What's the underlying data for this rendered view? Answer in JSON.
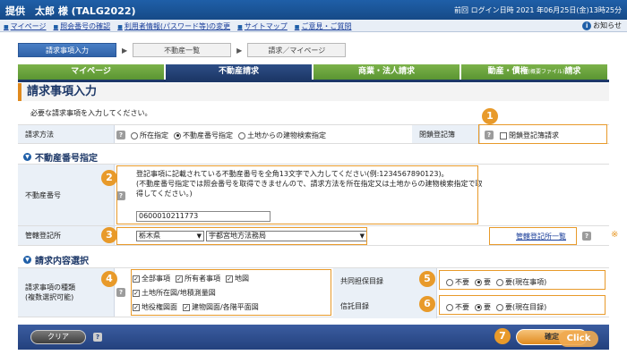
{
  "header": {
    "user_name": "提供　太郎 様 (TALG2022)",
    "last_login": "前回 ログイン日時 2021 年06月25日(金)13時25分"
  },
  "nav": {
    "links": [
      "マイページ",
      "照会番号の確認",
      "利用者情報(パスワード等)の変更",
      "サイトマップ",
      "ご意見・ご質問"
    ],
    "notice": "お知らせ"
  },
  "steps": [
    "請求事項入力",
    "不動産一覧",
    "請求／マイページ"
  ],
  "tabs": [
    {
      "label": "マイページ"
    },
    {
      "label": "不動産請求"
    },
    {
      "label": "商業・法人請求"
    },
    {
      "label": "動産・債権",
      "small": "(概要ファイル)",
      "suffix": "請求"
    }
  ],
  "page_title": "請求事項入力",
  "instruction": "必要な請求事項を入力してください。",
  "request_method": {
    "label": "請求方法",
    "options": [
      "所在指定",
      "不動産番号指定",
      "土地からの建物検索指定"
    ],
    "selected": "不動産番号指定",
    "closed_label": "閉鎖登記簿",
    "closed_checkbox": "閉鎖登記簿請求"
  },
  "property_section": {
    "heading": "不動産番号指定",
    "number_label": "不動産番号",
    "note_line1": "登記事項に記載されている不動産番号を全角13文字で入力してください(例:1234567890123)。",
    "note_line2": "(不動産番号指定では照会番号を取得できませんので、請求方法を所在指定又は土地からの建物検索指定で取得してください。)",
    "number_value": "0600010211773",
    "registry_label": "管轄登記所",
    "prefecture": "栃木県",
    "office": "宇都宮地方法務局",
    "registry_list_link": "管轄登記所一覧",
    "asterisk": "※"
  },
  "content_section": {
    "heading": "請求内容選択",
    "types_label_1": "請求事項の種類",
    "types_label_2": "(複数選択可能)",
    "types": [
      "全部事項",
      "所有者事項",
      "地図",
      "土地所在図/地積測量図",
      "地役権図面",
      "建物図面/各階平面図"
    ],
    "joint_label": "共同担保目録",
    "joint_options": [
      "不要",
      "要",
      "要(現在事項)"
    ],
    "joint_selected": "要",
    "trust_label": "信託目録",
    "trust_options": [
      "不要",
      "要",
      "要(現在目録)"
    ],
    "trust_selected": "要"
  },
  "footer": {
    "clear_label": "クリア",
    "confirm_label": "確定",
    "click_label": "Click"
  },
  "badges": [
    "1",
    "2",
    "3",
    "4",
    "5",
    "6",
    "7"
  ],
  "colors": {
    "accent_orange": "#e89a2a",
    "brand_blue": "#1f5fa8",
    "tab_green": "#6aa63e"
  }
}
